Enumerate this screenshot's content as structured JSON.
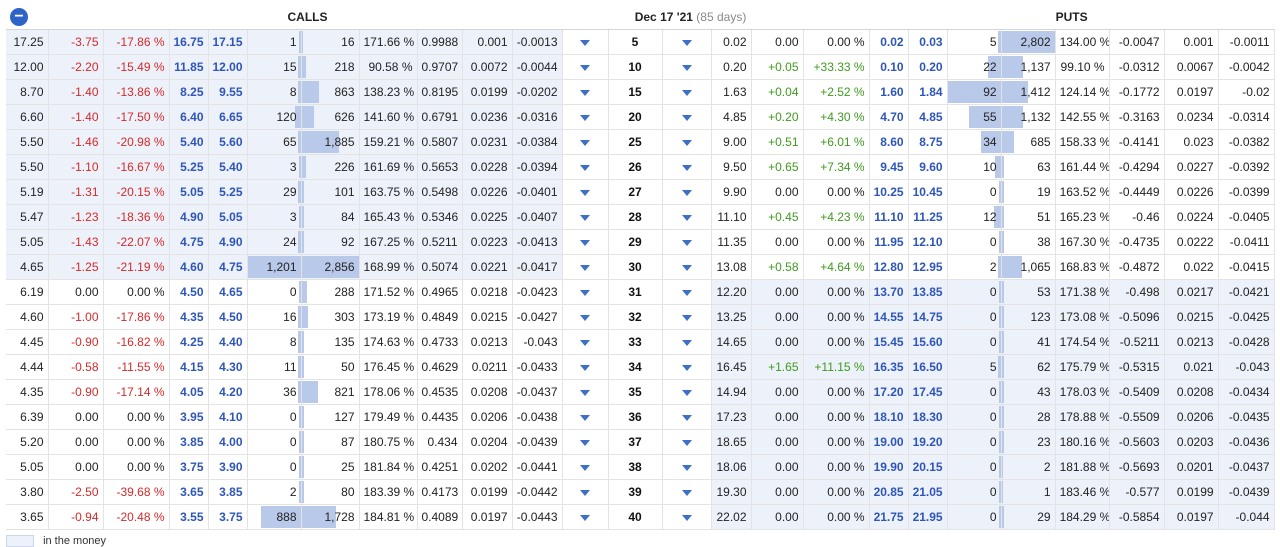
{
  "header": {
    "collapse_symbol": "−",
    "calls_label": "CALLS",
    "expiry_label": "Dec 17 '21",
    "expiry_days": "(85 days)",
    "puts_label": "PUTS"
  },
  "legend": {
    "label": "in the money"
  },
  "colors": {
    "accent": "#2e55b8",
    "negative": "#d42a2a",
    "positive": "#3f9a1f",
    "itm_bg": "#edf1fa",
    "bar": "#b9c9ea"
  },
  "icons": {
    "collapse": "collapse-circle-minus-icon",
    "expand": "caret-down-icon"
  },
  "rows": [
    {
      "strike": "5",
      "calls": {
        "last": "17.25",
        "chg": "-3.75",
        "pct": "-17.86 %",
        "bid": "16.75",
        "ask": "17.15",
        "vol": "1",
        "oi": "16",
        "iv": "171.66 %",
        "delta": "0.9988",
        "gamma": "0.001",
        "theta": "-0.0013",
        "volf": 0.0,
        "oif": 0.0
      },
      "puts": {
        "last": "0.02",
        "chg": "0.00",
        "pct": "0.00 %",
        "bid": "0.02",
        "ask": "0.03",
        "vol": "5",
        "oi": "2,802",
        "iv": "134.00 %",
        "delta": "-0.0047",
        "gamma": "0.001",
        "theta": "-0.0011",
        "volf": 0.05,
        "oif": 1.0
      }
    },
    {
      "strike": "10",
      "calls": {
        "last": "12.00",
        "chg": "-2.20",
        "pct": "-15.49 %",
        "bid": "11.85",
        "ask": "12.00",
        "vol": "15",
        "oi": "218",
        "iv": "90.58 %",
        "delta": "0.9707",
        "gamma": "0.0072",
        "theta": "-0.0044",
        "volf": 0.01,
        "oif": 0.08
      },
      "puts": {
        "last": "0.20",
        "chg": "+0.05",
        "pct": "+33.33 %",
        "bid": "0.10",
        "ask": "0.20",
        "vol": "22",
        "oi": "1,137",
        "iv": "99.10 %",
        "delta": "-0.0312",
        "gamma": "0.0067",
        "theta": "-0.0042",
        "volf": 0.24,
        "oif": 0.41
      }
    },
    {
      "strike": "15",
      "calls": {
        "last": "8.70",
        "chg": "-1.40",
        "pct": "-13.86 %",
        "bid": "8.25",
        "ask": "9.55",
        "vol": "8",
        "oi": "863",
        "iv": "138.23 %",
        "delta": "0.8195",
        "gamma": "0.0199",
        "theta": "-0.0202",
        "volf": 0.01,
        "oif": 0.3
      },
      "puts": {
        "last": "1.63",
        "chg": "+0.04",
        "pct": "+2.52 %",
        "bid": "1.60",
        "ask": "1.84",
        "vol": "92",
        "oi": "1,412",
        "iv": "124.14 %",
        "delta": "-0.1772",
        "gamma": "0.0197",
        "theta": "-0.02",
        "volf": 1.0,
        "oif": 0.5
      }
    },
    {
      "strike": "20",
      "calls": {
        "last": "6.60",
        "chg": "-1.40",
        "pct": "-17.50 %",
        "bid": "6.40",
        "ask": "6.65",
        "vol": "120",
        "oi": "626",
        "iv": "141.60 %",
        "delta": "0.6791",
        "gamma": "0.0236",
        "theta": "-0.0316",
        "volf": 0.1,
        "oif": 0.22
      },
      "puts": {
        "last": "4.85",
        "chg": "+0.20",
        "pct": "+4.30 %",
        "bid": "4.70",
        "ask": "4.85",
        "vol": "55",
        "oi": "1,132",
        "iv": "142.55 %",
        "delta": "-0.3163",
        "gamma": "0.0234",
        "theta": "-0.0314",
        "volf": 0.6,
        "oif": 0.4
      }
    },
    {
      "strike": "25",
      "calls": {
        "last": "5.50",
        "chg": "-1.46",
        "pct": "-20.98 %",
        "bid": "5.40",
        "ask": "5.60",
        "vol": "65",
        "oi": "1,885",
        "iv": "159.21 %",
        "delta": "0.5807",
        "gamma": "0.0231",
        "theta": "-0.0384",
        "volf": 0.05,
        "oif": 0.66
      },
      "puts": {
        "last": "9.00",
        "chg": "+0.51",
        "pct": "+6.01 %",
        "bid": "8.60",
        "ask": "8.75",
        "vol": "34",
        "oi": "685",
        "iv": "158.33 %",
        "delta": "-0.4141",
        "gamma": "0.023",
        "theta": "-0.0382",
        "volf": 0.37,
        "oif": 0.24
      }
    },
    {
      "strike": "26",
      "calls": {
        "last": "5.50",
        "chg": "-1.10",
        "pct": "-16.67 %",
        "bid": "5.25",
        "ask": "5.40",
        "vol": "3",
        "oi": "226",
        "iv": "161.69 %",
        "delta": "0.5653",
        "gamma": "0.0228",
        "theta": "-0.0394",
        "volf": 0.0,
        "oif": 0.08
      },
      "puts": {
        "last": "9.50",
        "chg": "+0.65",
        "pct": "+7.34 %",
        "bid": "9.45",
        "ask": "9.60",
        "vol": "10",
        "oi": "63",
        "iv": "161.44 %",
        "delta": "-0.4294",
        "gamma": "0.0227",
        "theta": "-0.0392",
        "volf": 0.11,
        "oif": 0.02
      }
    },
    {
      "strike": "27",
      "calls": {
        "last": "5.19",
        "chg": "-1.31",
        "pct": "-20.15 %",
        "bid": "5.05",
        "ask": "5.25",
        "vol": "29",
        "oi": "101",
        "iv": "163.75 %",
        "delta": "0.5498",
        "gamma": "0.0226",
        "theta": "-0.0401",
        "volf": 0.02,
        "oif": 0.04
      },
      "puts": {
        "last": "9.90",
        "chg": "0.00",
        "pct": "0.00 %",
        "bid": "10.25",
        "ask": "10.45",
        "vol": "0",
        "oi": "19",
        "iv": "163.52 %",
        "delta": "-0.4449",
        "gamma": "0.0226",
        "theta": "-0.0399",
        "volf": 0.0,
        "oif": 0.01
      }
    },
    {
      "strike": "28",
      "calls": {
        "last": "5.47",
        "chg": "-1.23",
        "pct": "-18.36 %",
        "bid": "4.90",
        "ask": "5.05",
        "vol": "3",
        "oi": "84",
        "iv": "165.43 %",
        "delta": "0.5346",
        "gamma": "0.0225",
        "theta": "-0.0407",
        "volf": 0.0,
        "oif": 0.03
      },
      "puts": {
        "last": "11.10",
        "chg": "+0.45",
        "pct": "+4.23 %",
        "bid": "11.10",
        "ask": "11.25",
        "vol": "12",
        "oi": "51",
        "iv": "165.23 %",
        "delta": "-0.46",
        "gamma": "0.0224",
        "theta": "-0.0405",
        "volf": 0.13,
        "oif": 0.02
      }
    },
    {
      "strike": "29",
      "calls": {
        "last": "5.05",
        "chg": "-1.43",
        "pct": "-22.07 %",
        "bid": "4.75",
        "ask": "4.90",
        "vol": "24",
        "oi": "92",
        "iv": "167.25 %",
        "delta": "0.5211",
        "gamma": "0.0223",
        "theta": "-0.0413",
        "volf": 0.02,
        "oif": 0.03
      },
      "puts": {
        "last": "11.35",
        "chg": "0.00",
        "pct": "0.00 %",
        "bid": "11.95",
        "ask": "12.10",
        "vol": "0",
        "oi": "38",
        "iv": "167.30 %",
        "delta": "-0.4735",
        "gamma": "0.0222",
        "theta": "-0.0411",
        "volf": 0.0,
        "oif": 0.01
      }
    },
    {
      "strike": "30",
      "calls": {
        "last": "4.65",
        "chg": "-1.25",
        "pct": "-21.19 %",
        "bid": "4.60",
        "ask": "4.75",
        "vol": "1,201",
        "oi": "2,856",
        "iv": "168.99 %",
        "delta": "0.5074",
        "gamma": "0.0221",
        "theta": "-0.0417",
        "volf": 1.0,
        "oif": 1.0
      },
      "puts": {
        "last": "13.08",
        "chg": "+0.58",
        "pct": "+4.64 %",
        "bid": "12.80",
        "ask": "12.95",
        "vol": "2",
        "oi": "1,065",
        "iv": "168.83 %",
        "delta": "-0.4872",
        "gamma": "0.022",
        "theta": "-0.0415",
        "volf": 0.02,
        "oif": 0.38
      }
    },
    {
      "strike": "31",
      "calls": {
        "last": "6.19",
        "chg": "0.00",
        "pct": "0.00 %",
        "bid": "4.50",
        "ask": "4.65",
        "vol": "0",
        "oi": "288",
        "iv": "171.52 %",
        "delta": "0.4965",
        "gamma": "0.0218",
        "theta": "-0.0423",
        "volf": 0.0,
        "oif": 0.1
      },
      "puts": {
        "last": "12.20",
        "chg": "0.00",
        "pct": "0.00 %",
        "bid": "13.70",
        "ask": "13.85",
        "vol": "0",
        "oi": "53",
        "iv": "171.38 %",
        "delta": "-0.498",
        "gamma": "0.0217",
        "theta": "-0.0421",
        "volf": 0.0,
        "oif": 0.02
      }
    },
    {
      "strike": "32",
      "calls": {
        "last": "4.60",
        "chg": "-1.00",
        "pct": "-17.86 %",
        "bid": "4.35",
        "ask": "4.50",
        "vol": "16",
        "oi": "303",
        "iv": "173.19 %",
        "delta": "0.4849",
        "gamma": "0.0215",
        "theta": "-0.0427",
        "volf": 0.01,
        "oif": 0.11
      },
      "puts": {
        "last": "13.25",
        "chg": "0.00",
        "pct": "0.00 %",
        "bid": "14.55",
        "ask": "14.75",
        "vol": "0",
        "oi": "123",
        "iv": "173.08 %",
        "delta": "-0.5096",
        "gamma": "0.0215",
        "theta": "-0.0425",
        "volf": 0.0,
        "oif": 0.04
      }
    },
    {
      "strike": "33",
      "calls": {
        "last": "4.45",
        "chg": "-0.90",
        "pct": "-16.82 %",
        "bid": "4.25",
        "ask": "4.40",
        "vol": "8",
        "oi": "135",
        "iv": "174.63 %",
        "delta": "0.4733",
        "gamma": "0.0213",
        "theta": "-0.043",
        "volf": 0.01,
        "oif": 0.05
      },
      "puts": {
        "last": "14.65",
        "chg": "0.00",
        "pct": "0.00 %",
        "bid": "15.45",
        "ask": "15.60",
        "vol": "0",
        "oi": "41",
        "iv": "174.54 %",
        "delta": "-0.5211",
        "gamma": "0.0213",
        "theta": "-0.0428",
        "volf": 0.0,
        "oif": 0.01
      }
    },
    {
      "strike": "34",
      "calls": {
        "last": "4.44",
        "chg": "-0.58",
        "pct": "-11.55 %",
        "bid": "4.15",
        "ask": "4.30",
        "vol": "11",
        "oi": "50",
        "iv": "176.45 %",
        "delta": "0.4629",
        "gamma": "0.0211",
        "theta": "-0.0433",
        "volf": 0.01,
        "oif": 0.02
      },
      "puts": {
        "last": "16.45",
        "chg": "+1.65",
        "pct": "+11.15 %",
        "bid": "16.35",
        "ask": "16.50",
        "vol": "5",
        "oi": "62",
        "iv": "175.79 %",
        "delta": "-0.5315",
        "gamma": "0.021",
        "theta": "-0.043",
        "volf": 0.05,
        "oif": 0.02
      }
    },
    {
      "strike": "35",
      "calls": {
        "last": "4.35",
        "chg": "-0.90",
        "pct": "-17.14 %",
        "bid": "4.05",
        "ask": "4.20",
        "vol": "36",
        "oi": "821",
        "iv": "178.06 %",
        "delta": "0.4535",
        "gamma": "0.0208",
        "theta": "-0.0437",
        "volf": 0.03,
        "oif": 0.29
      },
      "puts": {
        "last": "14.94",
        "chg": "0.00",
        "pct": "0.00 %",
        "bid": "17.20",
        "ask": "17.45",
        "vol": "0",
        "oi": "43",
        "iv": "178.03 %",
        "delta": "-0.5409",
        "gamma": "0.0208",
        "theta": "-0.0434",
        "volf": 0.0,
        "oif": 0.02
      }
    },
    {
      "strike": "36",
      "calls": {
        "last": "6.39",
        "chg": "0.00",
        "pct": "0.00 %",
        "bid": "3.95",
        "ask": "4.10",
        "vol": "0",
        "oi": "127",
        "iv": "179.49 %",
        "delta": "0.4435",
        "gamma": "0.0206",
        "theta": "-0.0438",
        "volf": 0.0,
        "oif": 0.04
      },
      "puts": {
        "last": "17.23",
        "chg": "0.00",
        "pct": "0.00 %",
        "bid": "18.10",
        "ask": "18.30",
        "vol": "0",
        "oi": "28",
        "iv": "178.88 %",
        "delta": "-0.5509",
        "gamma": "0.0206",
        "theta": "-0.0435",
        "volf": 0.0,
        "oif": 0.01
      }
    },
    {
      "strike": "37",
      "calls": {
        "last": "5.20",
        "chg": "0.00",
        "pct": "0.00 %",
        "bid": "3.85",
        "ask": "4.00",
        "vol": "0",
        "oi": "87",
        "iv": "180.75 %",
        "delta": "0.434",
        "gamma": "0.0204",
        "theta": "-0.0439",
        "volf": 0.0,
        "oif": 0.03
      },
      "puts": {
        "last": "18.65",
        "chg": "0.00",
        "pct": "0.00 %",
        "bid": "19.00",
        "ask": "19.20",
        "vol": "0",
        "oi": "23",
        "iv": "180.16 %",
        "delta": "-0.5603",
        "gamma": "0.0203",
        "theta": "-0.0436",
        "volf": 0.0,
        "oif": 0.01
      }
    },
    {
      "strike": "38",
      "calls": {
        "last": "5.05",
        "chg": "0.00",
        "pct": "0.00 %",
        "bid": "3.75",
        "ask": "3.90",
        "vol": "0",
        "oi": "25",
        "iv": "181.84 %",
        "delta": "0.4251",
        "gamma": "0.0202",
        "theta": "-0.0441",
        "volf": 0.0,
        "oif": 0.01
      },
      "puts": {
        "last": "18.06",
        "chg": "0.00",
        "pct": "0.00 %",
        "bid": "19.90",
        "ask": "20.15",
        "vol": "0",
        "oi": "2",
        "iv": "181.88 %",
        "delta": "-0.5693",
        "gamma": "0.0201",
        "theta": "-0.0437",
        "volf": 0.0,
        "oif": 0.0
      }
    },
    {
      "strike": "39",
      "calls": {
        "last": "3.80",
        "chg": "-2.50",
        "pct": "-39.68 %",
        "bid": "3.65",
        "ask": "3.85",
        "vol": "2",
        "oi": "80",
        "iv": "183.39 %",
        "delta": "0.4173",
        "gamma": "0.0199",
        "theta": "-0.0442",
        "volf": 0.0,
        "oif": 0.03
      },
      "puts": {
        "last": "19.30",
        "chg": "0.00",
        "pct": "0.00 %",
        "bid": "20.85",
        "ask": "21.05",
        "vol": "0",
        "oi": "1",
        "iv": "183.46 %",
        "delta": "-0.577",
        "gamma": "0.0199",
        "theta": "-0.0439",
        "volf": 0.0,
        "oif": 0.0
      }
    },
    {
      "strike": "40",
      "calls": {
        "last": "3.65",
        "chg": "-0.94",
        "pct": "-20.48 %",
        "bid": "3.55",
        "ask": "3.75",
        "vol": "888",
        "oi": "1,728",
        "iv": "184.81 %",
        "delta": "0.4089",
        "gamma": "0.0197",
        "theta": "-0.0443",
        "volf": 0.74,
        "oif": 0.6
      },
      "puts": {
        "last": "22.02",
        "chg": "0.00",
        "pct": "0.00 %",
        "bid": "21.75",
        "ask": "21.95",
        "vol": "0",
        "oi": "29",
        "iv": "184.29 %",
        "delta": "-0.5854",
        "gamma": "0.0197",
        "theta": "-0.044",
        "volf": 0.0,
        "oif": 0.01
      }
    }
  ]
}
